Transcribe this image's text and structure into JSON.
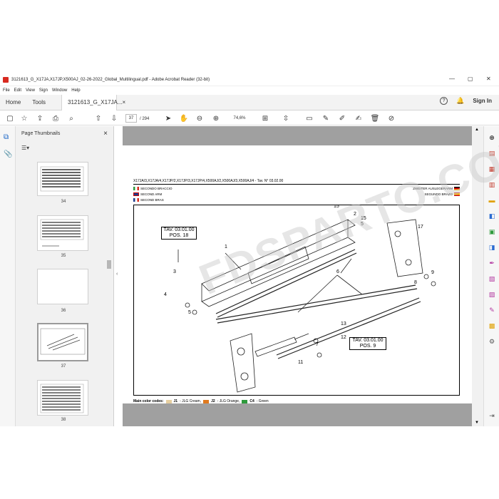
{
  "window": {
    "title": "3121613_G_X17JA,X17JP,X500AJ_02-26-2022_Global_Multilingual.pdf - Adobe Acrobat Reader (32-bit)",
    "minimize": "—",
    "maximize": "▢",
    "close": "✕"
  },
  "menu": [
    "File",
    "Edit",
    "View",
    "Sign",
    "Window",
    "Help"
  ],
  "tabs": {
    "home": "Home",
    "tools": "Tools",
    "doc": "3121613_G_X17JA...",
    "doc_close": "×",
    "sign_in": "Sign In"
  },
  "toolbar": {
    "page_current": "37",
    "page_total": "/ 294",
    "zoom": "74,6%"
  },
  "panel": {
    "title": "Page Thumbnails",
    "close": "×",
    "thumbs": [
      {
        "label": "34"
      },
      {
        "label": "35"
      },
      {
        "label": "36"
      },
      {
        "label": "37"
      },
      {
        "label": "38"
      }
    ]
  },
  "document": {
    "header": "X17JA/3,X17JA/4,X17JP/2,X17JP/3,X17JP/4,X500AJ/2,X500AJ/3,X500AJ/4 - Tav. N° 03.02.00",
    "lang_it": "SECONDO BRACCIO",
    "lang_en": "SECOND ARM",
    "lang_fr": "SECOND BRAS",
    "lang_de": "ZWEITER AUSLEGERARM",
    "lang_es": "SEGUNDO BRAZO",
    "callout1": {
      "line1": "TAV. 03.01.00",
      "line2": "POS. 18"
    },
    "callout2": {
      "line1": "TAV. 03.01.00",
      "line2": "POS. 9"
    },
    "positions": [
      "1",
      "2",
      "3",
      "4",
      "5",
      "5",
      "6",
      "7",
      "8",
      "9",
      "11",
      "12",
      "13",
      "15",
      "15",
      "17"
    ],
    "color_codes_label": "Main color codes:",
    "color_codes": [
      {
        "code": "J1",
        "name": " - JLG Cream,",
        "color": "#e6cfa0"
      },
      {
        "code": "J2",
        "name": " - JLG Orange,",
        "color": "#e07a1f"
      },
      {
        "code": "C4",
        "name": " - Green",
        "color": "#2e9a3c"
      }
    ]
  },
  "watermark": "FDSPARTO.COM"
}
